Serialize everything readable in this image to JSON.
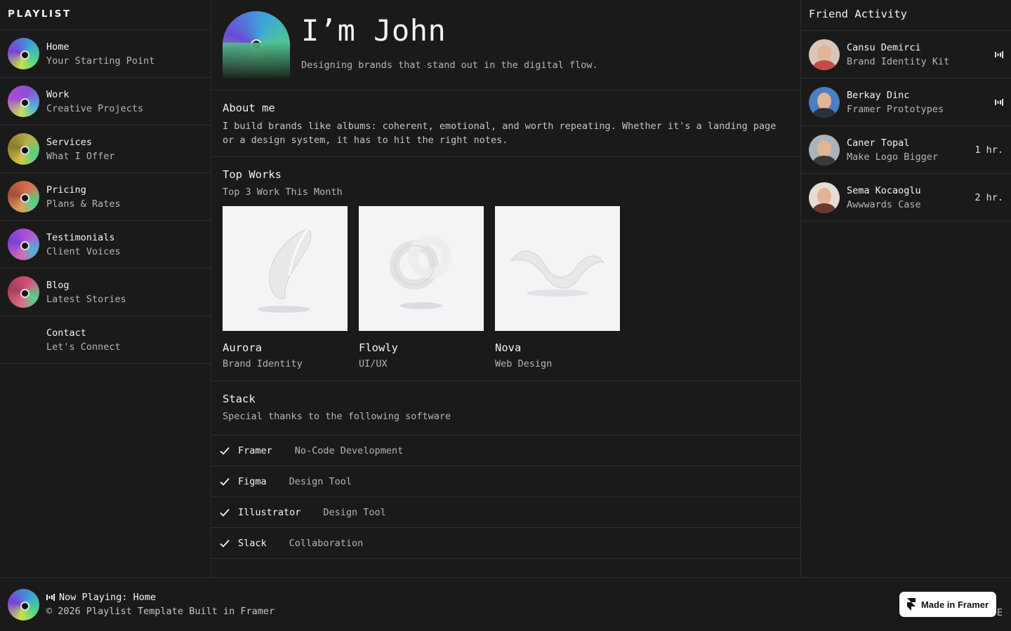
{
  "brand": "PLAYLIST",
  "nav": [
    {
      "title": "Home",
      "subtitle": "Your Starting Point",
      "disc": [
        "#3d9bd9",
        "#4fd58a",
        "#c7e24c",
        "#7a3fd6"
      ]
    },
    {
      "title": "Work",
      "subtitle": "Creative Projects",
      "disc": [
        "#8c4fd6",
        "#4fb2d9",
        "#c8e05a",
        "#a34fd6"
      ]
    },
    {
      "title": "Services",
      "subtitle": "What I Offer",
      "disc": [
        "#b8b04a",
        "#4fd58a",
        "#d6c24a",
        "#8b7a2c"
      ]
    },
    {
      "title": "Pricing",
      "subtitle": "Plans & Rates",
      "disc": [
        "#d9704f",
        "#4fd58a",
        "#e0a05a",
        "#a34f3a"
      ]
    },
    {
      "title": "Testimonials",
      "subtitle": "Client Voices",
      "disc": [
        "#b84fd6",
        "#4fb2d9",
        "#d56ab0",
        "#7a3fd6"
      ]
    },
    {
      "title": "Blog",
      "subtitle": "Latest Stories",
      "disc": [
        "#d94f7a",
        "#4fd58a",
        "#e06a8a",
        "#a33f5a"
      ]
    },
    {
      "title": "Contact",
      "subtitle": "Let's Connect",
      "disc": null
    }
  ],
  "hero": {
    "title": "I’m John",
    "subtitle": "Designing brands that stand out in the digital flow."
  },
  "about": {
    "heading": "About me",
    "body": "I build brands like albums: coherent, emotional, and worth repeating. Whether it's a landing page or a design system, it has to hit the right notes."
  },
  "works": {
    "heading": "Top Works",
    "subtitle": "Top 3 Work This Month",
    "items": [
      {
        "title": "Aurora",
        "category": "Brand Identity",
        "shape": "leaf"
      },
      {
        "title": "Flowly",
        "category": "UI/UX",
        "shape": "knot"
      },
      {
        "title": "Nova",
        "category": "Web Design",
        "shape": "wave"
      }
    ]
  },
  "stack": {
    "heading": "Stack",
    "subtitle": "Special thanks to the following software",
    "items": [
      {
        "name": "Framer",
        "desc": "No-Code Development"
      },
      {
        "name": "Figma",
        "desc": "Design Tool"
      },
      {
        "name": "Illustrator",
        "desc": "Design Tool"
      },
      {
        "name": "Slack",
        "desc": "Collaboration"
      }
    ]
  },
  "friends": {
    "heading": "Friend Activity",
    "items": [
      {
        "name": "Cansu Demirci",
        "activity": "Brand Identity Kit",
        "status": "",
        "playing": true,
        "bg": "#d8c7b8",
        "shirt": "#c94a4a"
      },
      {
        "name": "Berkay Dinc",
        "activity": "Framer Prototypes",
        "status": "",
        "playing": true,
        "bg": "#4a7fc1",
        "shirt": "#2a2f3a"
      },
      {
        "name": "Caner Topal",
        "activity": "Make Logo Bigger",
        "status": "1 hr.",
        "playing": false,
        "bg": "#a7b3bd",
        "shirt": "#3a3a3a"
      },
      {
        "name": "Sema Kocaoglu",
        "activity": "Awwwards Case",
        "status": "2 hr.",
        "playing": false,
        "bg": "#e8dcd2",
        "shirt": "#6b3a2a"
      }
    ]
  },
  "footer": {
    "now_playing": "Now Playing: Home",
    "copyright": "© 2026 Playlist Template Built in Framer",
    "badge": "Made in Framer",
    "right_text": "E"
  }
}
